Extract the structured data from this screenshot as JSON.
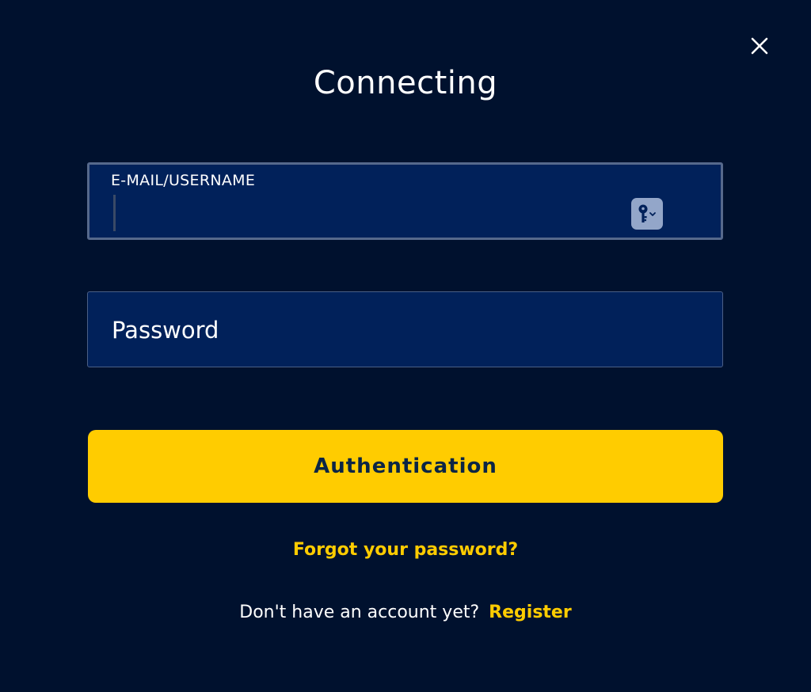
{
  "modal": {
    "title": "Connecting",
    "close_icon": "close-icon"
  },
  "email_field": {
    "label": "E-MAIL/USERNAME",
    "value": "",
    "autofill_icon": "key-icon"
  },
  "password_field": {
    "placeholder": "Password",
    "value": ""
  },
  "auth_button": {
    "label": "Authentication"
  },
  "forgot_link": {
    "label": "Forgot your password?"
  },
  "register": {
    "prompt": "Don't have an account yet?",
    "link": "Register"
  },
  "colors": {
    "background": "#00112e",
    "field_background": "#01215a",
    "accent": "#ffcc00",
    "button_text": "#0b2545"
  }
}
